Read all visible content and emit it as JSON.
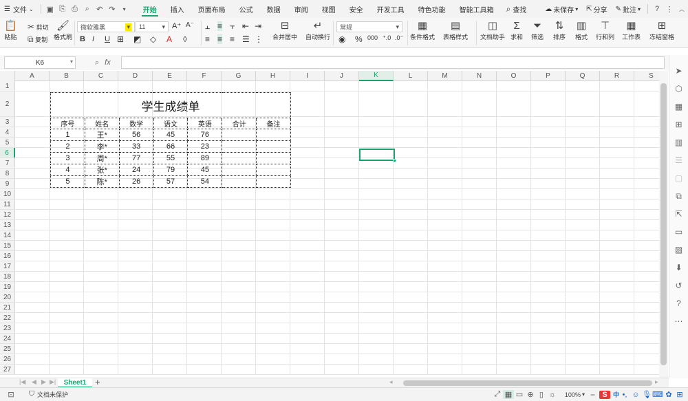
{
  "menubar": {
    "file_label": "文件",
    "tabs": [
      "开始",
      "插入",
      "页面布局",
      "公式",
      "数据",
      "审阅",
      "视图",
      "安全",
      "开发工具",
      "特色功能",
      "智能工具箱"
    ],
    "search_label": "查找",
    "unsaved_label": "未保存",
    "share_label": "分享",
    "comment_label": "批注"
  },
  "ribbon": {
    "paste": "粘贴",
    "cut": "剪切",
    "copy": "复制",
    "format_painter": "格式刷",
    "font_name": "微软雅黑",
    "font_size": "11",
    "merge_center": "合并居中",
    "wrap_text": "自动换行",
    "number_format": "常规",
    "conditional_format": "条件格式",
    "table_style": "表格样式",
    "doc_assistant": "文档助手",
    "sum": "求和",
    "filter": "筛选",
    "sort": "排序",
    "format": "格式",
    "row_col": "行和列",
    "worksheet": "工作表",
    "freeze": "冻结窗格"
  },
  "formulabar": {
    "cell_ref": "K6",
    "fx_label": "fx",
    "value": ""
  },
  "grid": {
    "columns": [
      "A",
      "B",
      "C",
      "D",
      "E",
      "F",
      "G",
      "H",
      "I",
      "J",
      "K",
      "L",
      "M",
      "N",
      "O",
      "P",
      "Q",
      "R",
      "S"
    ],
    "active_column": "K",
    "active_row": 6,
    "row_count": 27
  },
  "table": {
    "title": "学生成绩单",
    "headers": [
      "序号",
      "姓名",
      "数学",
      "语文",
      "英语",
      "合计",
      "备注"
    ],
    "rows": [
      [
        "1",
        "王*",
        "56",
        "45",
        "76",
        "",
        ""
      ],
      [
        "2",
        "李*",
        "33",
        "66",
        "23",
        "",
        ""
      ],
      [
        "3",
        "周*",
        "77",
        "55",
        "89",
        "",
        ""
      ],
      [
        "4",
        "张*",
        "24",
        "79",
        "45",
        "",
        ""
      ],
      [
        "5",
        "陈*",
        "26",
        "57",
        "54",
        "",
        ""
      ]
    ]
  },
  "sheet_tabs": {
    "active": "Sheet1"
  },
  "statusbar": {
    "protect_label": "文档未保护",
    "zoom": "100%"
  },
  "colors": {
    "accent": "#1aa36f"
  }
}
